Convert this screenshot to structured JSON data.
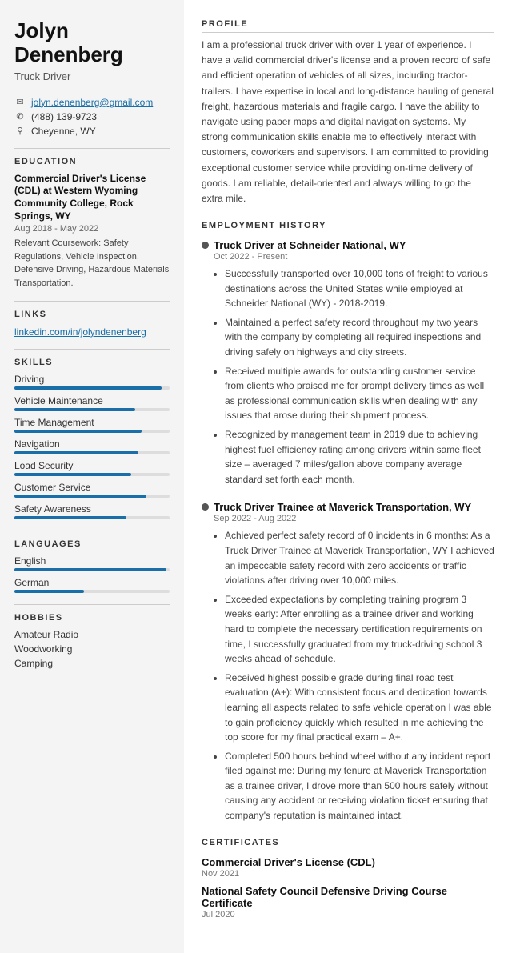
{
  "sidebar": {
    "name": "Jolyn Denenberg",
    "job_title": "Truck Driver",
    "contact": {
      "email": "jolyn.denenberg@gmail.com",
      "phone": "(488) 139-9723",
      "location": "Cheyenne, WY"
    },
    "education_heading": "EDUCATION",
    "education": {
      "degree": "Commercial Driver's License (CDL) at Western Wyoming Community College, Rock Springs, WY",
      "date": "Aug 2018 - May 2022",
      "coursework_label": "Relevant Coursework:",
      "coursework": "Safety Regulations, Vehicle Inspection, Defensive Driving, Hazardous Materials Transportation."
    },
    "links_heading": "LINKS",
    "link": "linkedin.com/in/jolyndenenberg",
    "skills_heading": "SKILLS",
    "skills": [
      {
        "label": "Driving",
        "percent": 95
      },
      {
        "label": "Vehicle Maintenance",
        "percent": 78
      },
      {
        "label": "Time Management",
        "percent": 82
      },
      {
        "label": "Navigation",
        "percent": 80
      },
      {
        "label": "Load Security",
        "percent": 75
      },
      {
        "label": "Customer Service",
        "percent": 85
      },
      {
        "label": "Safety Awareness",
        "percent": 72
      }
    ],
    "languages_heading": "LANGUAGES",
    "languages": [
      {
        "label": "English",
        "percent": 98
      },
      {
        "label": "German",
        "percent": 45
      }
    ],
    "hobbies_heading": "HOBBIES",
    "hobbies": [
      "Amateur Radio",
      "Woodworking",
      "Camping"
    ]
  },
  "main": {
    "profile_heading": "PROFILE",
    "profile_text": "I am a professional truck driver with over 1 year of experience. I have a valid commercial driver's license and a proven record of safe and efficient operation of vehicles of all sizes, including tractor-trailers. I have expertise in local and long-distance hauling of general freight, hazardous materials and fragile cargo. I have the ability to navigate using paper maps and digital navigation systems. My strong communication skills enable me to effectively interact with customers, coworkers and supervisors. I am committed to providing exceptional customer service while providing on-time delivery of goods. I am reliable, detail-oriented and always willing to go the extra mile.",
    "employment_heading": "EMPLOYMENT HISTORY",
    "jobs": [
      {
        "title": "Truck Driver at Schneider National, WY",
        "date": "Oct 2022 - Present",
        "bullets": [
          "Successfully transported over 10,000 tons of freight to various destinations across the United States while employed at Schneider National (WY) - 2018-2019.",
          "Maintained a perfect safety record throughout my two years with the company by completing all required inspections and driving safely on highways and city streets.",
          "Received multiple awards for outstanding customer service from clients who praised me for prompt delivery times as well as professional communication skills when dealing with any issues that arose during their shipment process.",
          "Recognized by management team in 2019 due to achieving highest fuel efficiency rating among drivers within same fleet size – averaged 7 miles/gallon above company average standard set forth each month."
        ]
      },
      {
        "title": "Truck Driver Trainee at Maverick Transportation, WY",
        "date": "Sep 2022 - Aug 2022",
        "bullets": [
          "Achieved perfect safety record of 0 incidents in 6 months: As a Truck Driver Trainee at Maverick Transportation, WY I achieved an impeccable safety record with zero accidents or traffic violations after driving over 10,000 miles.",
          "Exceeded expectations by completing training program 3 weeks early: After enrolling as a trainee driver and working hard to complete the necessary certification requirements on time, I successfully graduated from my truck-driving school 3 weeks ahead of schedule.",
          "Received highest possible grade during final road test evaluation (A+): With consistent focus and dedication towards learning all aspects related to safe vehicle operation I was able to gain proficiency quickly which resulted in me achieving the top score for my final practical exam – A+.",
          "Completed 500 hours behind wheel without any incident report filed against me: During my tenure at Maverick Transportation as a trainee driver, I drove more than 500 hours safely without causing any accident or receiving violation ticket ensuring that company's reputation is maintained intact."
        ]
      }
    ],
    "certificates_heading": "CERTIFICATES",
    "certificates": [
      {
        "name": "Commercial Driver's License (CDL)",
        "date": "Nov 2021"
      },
      {
        "name": "National Safety Council Defensive Driving Course Certificate",
        "date": "Jul 2020"
      }
    ]
  }
}
